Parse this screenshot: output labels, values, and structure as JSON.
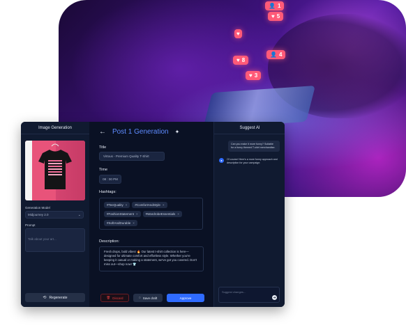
{
  "background": {
    "notifications": [
      {
        "icon": "user-icon",
        "count": "1"
      },
      {
        "icon": "heart-icon",
        "count": "5"
      },
      {
        "icon": "heart-icon",
        "count": "8"
      },
      {
        "icon": "user-icon",
        "count": "4"
      },
      {
        "icon": "heart-icon",
        "count": "3"
      },
      {
        "icon": "heart-icon",
        "count": ""
      }
    ]
  },
  "left_panel": {
    "title": "Image Generation",
    "model_label": "Generation Model",
    "model_value": "Midjourney 2.0",
    "prompt_label": "Prompt",
    "prompt_placeholder": "Talk about your art...",
    "regenerate_label": "Regenerate"
  },
  "middle_panel": {
    "title": "Post 1 Generation",
    "title_label": "Title",
    "title_value": "Virtous - Premium Quality T-Shirt",
    "time_label": "Time",
    "time_value": "08 : 00 PM",
    "hashtags_label": "Hashtags:",
    "hashtags": [
      "#TeeQuality",
      "#ComfortAndStyle",
      "#FashionStatement",
      "#WardrobeEssentials",
      "#SoftAndDurable"
    ],
    "description_label": "Description:",
    "description": "Fresh drops, bold vibes! 🔥 Our latest t-shirt collection is here—designed for ultimate comfort and effortless style. Whether you're keeping it casual or making a statement, we've got you covered. Don't miss out—shop now! 👕",
    "buttons": {
      "discard": "Discard",
      "save_draft": "Save draft",
      "approve": "Approve"
    }
  },
  "right_panel": {
    "title": "Suggest AI",
    "user_message": "Can you make it more funny? Suitable for a funny themed T-shirt merchandise.",
    "ai_message": "Of course! Here's a more funny approach and description for your campaign:",
    "input_placeholder": "Suggest changes..."
  },
  "colors": {
    "accent": "#2f6bff",
    "panel": "#101a30",
    "background": "#0a1124",
    "discard": "#e03b3b"
  }
}
